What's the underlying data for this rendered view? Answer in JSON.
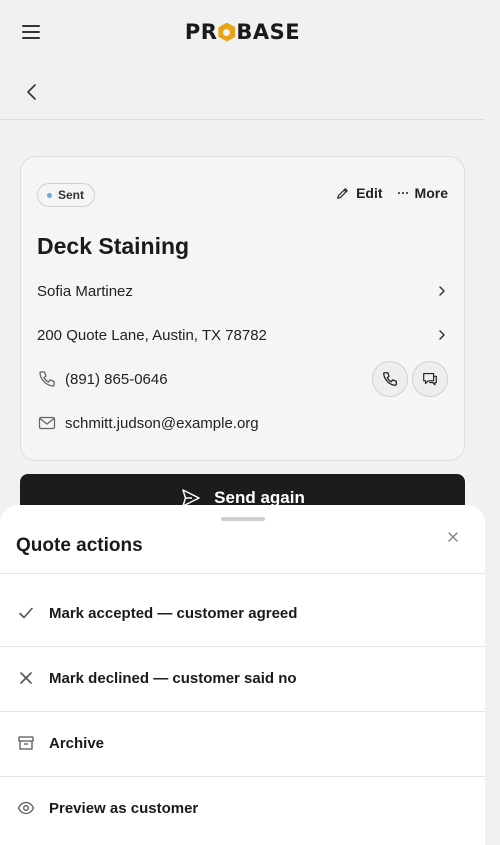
{
  "header": {
    "logo_text_left": "PR",
    "logo_text_right": "BASE",
    "menu_icon": "hamburger-menu-icon",
    "back_icon": "chevron-left-icon"
  },
  "quote": {
    "status": "Sent",
    "status_color": "#6aa7e8",
    "edit_label": "Edit",
    "more_label": "More",
    "title": "Deck Staining",
    "customer_name": "Sofia Martinez",
    "address": "200 Quote Lane, Austin, TX 78782",
    "phone": "(891) 865-0646",
    "email": "schmitt.judson@example.org"
  },
  "send_again_label": "Send again",
  "sheet": {
    "title": "Quote actions",
    "items": [
      {
        "label": "Mark accepted — customer agreed",
        "icon": "check-icon"
      },
      {
        "label": "Mark declined — customer said no",
        "icon": "x-icon"
      },
      {
        "label": "Archive",
        "icon": "archive-icon"
      },
      {
        "label": "Preview as customer",
        "icon": "eye-icon"
      }
    ]
  }
}
